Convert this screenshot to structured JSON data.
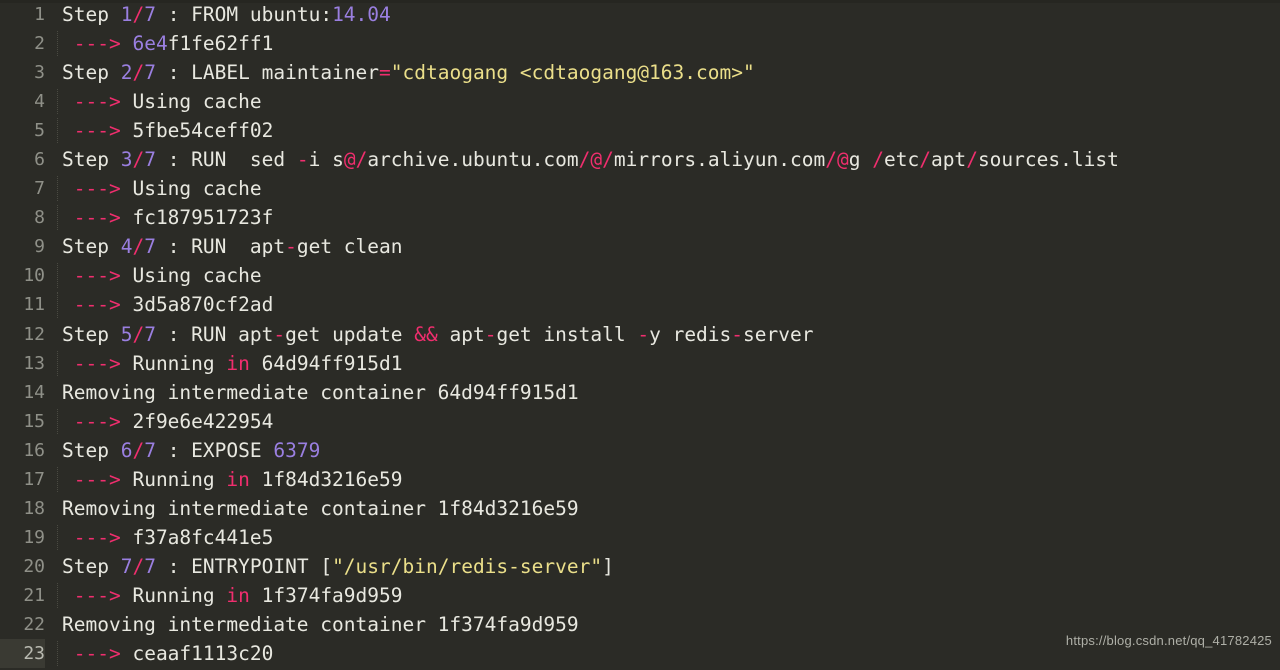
{
  "app": {
    "kind": "code-editor-terminal-output",
    "title": "Docker build output",
    "background": "#2b2b26",
    "active_line": 23,
    "total_lines": 23
  },
  "colors": {
    "background": "#2b2b26",
    "foreground": "#e8e8e0",
    "gutter_text": "#8f9088",
    "active_gutter_bg": "#3a3a33",
    "number": "#9a7fe0",
    "operator": "#f02e6e",
    "string": "#ebdf8a",
    "indent_guide": "#4a4a42",
    "watermark": "#b6b7ae"
  },
  "watermark": {
    "text": "https://blog.csdn.net/qq_41782425"
  },
  "lines": [
    {
      "number": "1",
      "indented": false,
      "tokens": [
        {
          "t": "Step ",
          "c": "plain"
        },
        {
          "t": "1",
          "c": "num"
        },
        {
          "t": "/",
          "c": "op"
        },
        {
          "t": "7",
          "c": "num"
        },
        {
          "t": " : FROM ubuntu:",
          "c": "plain"
        },
        {
          "t": "14.04",
          "c": "num"
        }
      ]
    },
    {
      "number": "2",
      "indented": true,
      "tokens": [
        {
          "t": " ",
          "c": "plain"
        },
        {
          "t": "---&gt;",
          "c": "arrow"
        },
        {
          "t": " ",
          "c": "plain"
        },
        {
          "t": "6e4",
          "c": "num"
        },
        {
          "t": "f1fe62ff1",
          "c": "plain"
        }
      ]
    },
    {
      "number": "3",
      "indented": false,
      "tokens": [
        {
          "t": "Step ",
          "c": "plain"
        },
        {
          "t": "2",
          "c": "num"
        },
        {
          "t": "/",
          "c": "op"
        },
        {
          "t": "7",
          "c": "num"
        },
        {
          "t": " : LABEL maintainer",
          "c": "plain"
        },
        {
          "t": "=",
          "c": "op"
        },
        {
          "t": "\"cdtaogang &lt;cdtaogang@163.com&gt;\"",
          "c": "str"
        }
      ]
    },
    {
      "number": "4",
      "indented": true,
      "tokens": [
        {
          "t": " ",
          "c": "plain"
        },
        {
          "t": "---&gt;",
          "c": "arrow"
        },
        {
          "t": " Using cache",
          "c": "plain"
        }
      ]
    },
    {
      "number": "5",
      "indented": true,
      "tokens": [
        {
          "t": " ",
          "c": "plain"
        },
        {
          "t": "---&gt;",
          "c": "arrow"
        },
        {
          "t": " 5fbe54ceff02",
          "c": "plain"
        }
      ]
    },
    {
      "number": "6",
      "indented": false,
      "tokens": [
        {
          "t": "Step ",
          "c": "plain"
        },
        {
          "t": "3",
          "c": "num"
        },
        {
          "t": "/",
          "c": "op"
        },
        {
          "t": "7",
          "c": "num"
        },
        {
          "t": " : RUN  sed ",
          "c": "plain"
        },
        {
          "t": "-",
          "c": "op"
        },
        {
          "t": "i s",
          "c": "plain"
        },
        {
          "t": "@",
          "c": "op"
        },
        {
          "t": "/",
          "c": "op"
        },
        {
          "t": "archive.ubuntu.com",
          "c": "plain"
        },
        {
          "t": "/",
          "c": "op"
        },
        {
          "t": "@",
          "c": "op"
        },
        {
          "t": "/",
          "c": "op"
        },
        {
          "t": "mirrors.aliyun.com",
          "c": "plain"
        },
        {
          "t": "/",
          "c": "op"
        },
        {
          "t": "@",
          "c": "op"
        },
        {
          "t": "g ",
          "c": "plain"
        },
        {
          "t": "/",
          "c": "op"
        },
        {
          "t": "etc",
          "c": "plain"
        },
        {
          "t": "/",
          "c": "op"
        },
        {
          "t": "apt",
          "c": "plain"
        },
        {
          "t": "/",
          "c": "op"
        },
        {
          "t": "sources.list",
          "c": "plain"
        }
      ]
    },
    {
      "number": "7",
      "indented": true,
      "tokens": [
        {
          "t": " ",
          "c": "plain"
        },
        {
          "t": "---&gt;",
          "c": "arrow"
        },
        {
          "t": " Using cache",
          "c": "plain"
        }
      ]
    },
    {
      "number": "8",
      "indented": true,
      "tokens": [
        {
          "t": " ",
          "c": "plain"
        },
        {
          "t": "---&gt;",
          "c": "arrow"
        },
        {
          "t": " fc187951723f",
          "c": "plain"
        }
      ]
    },
    {
      "number": "9",
      "indented": false,
      "tokens": [
        {
          "t": "Step ",
          "c": "plain"
        },
        {
          "t": "4",
          "c": "num"
        },
        {
          "t": "/",
          "c": "op"
        },
        {
          "t": "7",
          "c": "num"
        },
        {
          "t": " : RUN  apt",
          "c": "plain"
        },
        {
          "t": "-",
          "c": "op"
        },
        {
          "t": "get clean",
          "c": "plain"
        }
      ]
    },
    {
      "number": "10",
      "indented": true,
      "tokens": [
        {
          "t": " ",
          "c": "plain"
        },
        {
          "t": "---&gt;",
          "c": "arrow"
        },
        {
          "t": " Using cache",
          "c": "plain"
        }
      ]
    },
    {
      "number": "11",
      "indented": true,
      "tokens": [
        {
          "t": " ",
          "c": "plain"
        },
        {
          "t": "---&gt;",
          "c": "arrow"
        },
        {
          "t": " 3d5a870cf2ad",
          "c": "plain"
        }
      ]
    },
    {
      "number": "12",
      "indented": false,
      "tokens": [
        {
          "t": "Step ",
          "c": "plain"
        },
        {
          "t": "5",
          "c": "num"
        },
        {
          "t": "/",
          "c": "op"
        },
        {
          "t": "7",
          "c": "num"
        },
        {
          "t": " : RUN apt",
          "c": "plain"
        },
        {
          "t": "-",
          "c": "op"
        },
        {
          "t": "get update ",
          "c": "plain"
        },
        {
          "t": "&amp;&amp;",
          "c": "op"
        },
        {
          "t": " apt",
          "c": "plain"
        },
        {
          "t": "-",
          "c": "op"
        },
        {
          "t": "get install ",
          "c": "plain"
        },
        {
          "t": "-",
          "c": "op"
        },
        {
          "t": "y redis",
          "c": "plain"
        },
        {
          "t": "-",
          "c": "op"
        },
        {
          "t": "server",
          "c": "plain"
        }
      ]
    },
    {
      "number": "13",
      "indented": true,
      "tokens": [
        {
          "t": " ",
          "c": "plain"
        },
        {
          "t": "---&gt;",
          "c": "arrow"
        },
        {
          "t": " Running ",
          "c": "plain"
        },
        {
          "t": "in",
          "c": "inkw"
        },
        {
          "t": " 64d94ff915d1",
          "c": "plain"
        }
      ]
    },
    {
      "number": "14",
      "indented": false,
      "tokens": [
        {
          "t": "Removing intermediate container 64d94ff915d1",
          "c": "plain"
        }
      ]
    },
    {
      "number": "15",
      "indented": true,
      "tokens": [
        {
          "t": " ",
          "c": "plain"
        },
        {
          "t": "---&gt;",
          "c": "arrow"
        },
        {
          "t": " 2f9e6e422954",
          "c": "plain"
        }
      ]
    },
    {
      "number": "16",
      "indented": false,
      "tokens": [
        {
          "t": "Step ",
          "c": "plain"
        },
        {
          "t": "6",
          "c": "num"
        },
        {
          "t": "/",
          "c": "op"
        },
        {
          "t": "7",
          "c": "num"
        },
        {
          "t": " : EXPOSE ",
          "c": "plain"
        },
        {
          "t": "6379",
          "c": "num"
        }
      ]
    },
    {
      "number": "17",
      "indented": true,
      "tokens": [
        {
          "t": " ",
          "c": "plain"
        },
        {
          "t": "---&gt;",
          "c": "arrow"
        },
        {
          "t": " Running ",
          "c": "plain"
        },
        {
          "t": "in",
          "c": "inkw"
        },
        {
          "t": " 1f84d3216e59",
          "c": "plain"
        }
      ]
    },
    {
      "number": "18",
      "indented": false,
      "tokens": [
        {
          "t": "Removing intermediate container 1f84d3216e59",
          "c": "plain"
        }
      ]
    },
    {
      "number": "19",
      "indented": true,
      "tokens": [
        {
          "t": " ",
          "c": "plain"
        },
        {
          "t": "---&gt;",
          "c": "arrow"
        },
        {
          "t": " f37a8fc441e5",
          "c": "plain"
        }
      ]
    },
    {
      "number": "20",
      "indented": false,
      "tokens": [
        {
          "t": "Step ",
          "c": "plain"
        },
        {
          "t": "7",
          "c": "num"
        },
        {
          "t": "/",
          "c": "op"
        },
        {
          "t": "7",
          "c": "num"
        },
        {
          "t": " : ENTRYPOINT [",
          "c": "plain"
        },
        {
          "t": "\"/usr/bin/redis-server\"",
          "c": "str"
        },
        {
          "t": "]",
          "c": "plain"
        }
      ]
    },
    {
      "number": "21",
      "indented": true,
      "tokens": [
        {
          "t": " ",
          "c": "plain"
        },
        {
          "t": "---&gt;",
          "c": "arrow"
        },
        {
          "t": " Running ",
          "c": "plain"
        },
        {
          "t": "in",
          "c": "inkw"
        },
        {
          "t": " 1f374fa9d959",
          "c": "plain"
        }
      ]
    },
    {
      "number": "22",
      "indented": false,
      "tokens": [
        {
          "t": "Removing intermediate container 1f374fa9d959",
          "c": "plain"
        }
      ]
    },
    {
      "number": "23",
      "indented": true,
      "active": true,
      "tokens": [
        {
          "t": " ",
          "c": "plain"
        },
        {
          "t": "---&gt;",
          "c": "arrow"
        },
        {
          "t": " ceaaf1113c20",
          "c": "plain"
        }
      ]
    }
  ]
}
